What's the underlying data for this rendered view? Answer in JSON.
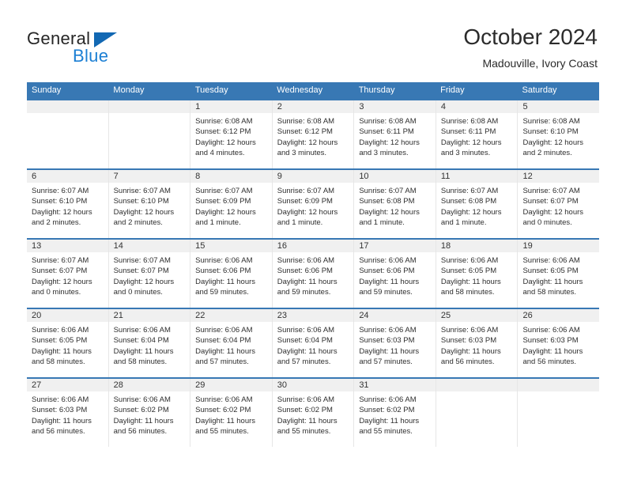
{
  "logo": {
    "word1": "General",
    "word2": "Blue",
    "triangle_color": "#1268b3",
    "blue_color": "#1b7fd4"
  },
  "header": {
    "title": "October 2024",
    "subtitle": "Madouville, Ivory Coast",
    "header_bg": "#3878b4",
    "header_text_color": "#ffffff"
  },
  "calendar": {
    "weekdays": [
      "Sunday",
      "Monday",
      "Tuesday",
      "Wednesday",
      "Thursday",
      "Friday",
      "Saturday"
    ],
    "weeks": [
      [
        {
          "day": "",
          "empty": true
        },
        {
          "day": "",
          "empty": true
        },
        {
          "day": "1",
          "sunrise": "Sunrise: 6:08 AM",
          "sunset": "Sunset: 6:12 PM",
          "daylight1": "Daylight: 12 hours",
          "daylight2": "and 4 minutes."
        },
        {
          "day": "2",
          "sunrise": "Sunrise: 6:08 AM",
          "sunset": "Sunset: 6:12 PM",
          "daylight1": "Daylight: 12 hours",
          "daylight2": "and 3 minutes."
        },
        {
          "day": "3",
          "sunrise": "Sunrise: 6:08 AM",
          "sunset": "Sunset: 6:11 PM",
          "daylight1": "Daylight: 12 hours",
          "daylight2": "and 3 minutes."
        },
        {
          "day": "4",
          "sunrise": "Sunrise: 6:08 AM",
          "sunset": "Sunset: 6:11 PM",
          "daylight1": "Daylight: 12 hours",
          "daylight2": "and 3 minutes."
        },
        {
          "day": "5",
          "sunrise": "Sunrise: 6:08 AM",
          "sunset": "Sunset: 6:10 PM",
          "daylight1": "Daylight: 12 hours",
          "daylight2": "and 2 minutes."
        }
      ],
      [
        {
          "day": "6",
          "sunrise": "Sunrise: 6:07 AM",
          "sunset": "Sunset: 6:10 PM",
          "daylight1": "Daylight: 12 hours",
          "daylight2": "and 2 minutes."
        },
        {
          "day": "7",
          "sunrise": "Sunrise: 6:07 AM",
          "sunset": "Sunset: 6:10 PM",
          "daylight1": "Daylight: 12 hours",
          "daylight2": "and 2 minutes."
        },
        {
          "day": "8",
          "sunrise": "Sunrise: 6:07 AM",
          "sunset": "Sunset: 6:09 PM",
          "daylight1": "Daylight: 12 hours",
          "daylight2": "and 1 minute."
        },
        {
          "day": "9",
          "sunrise": "Sunrise: 6:07 AM",
          "sunset": "Sunset: 6:09 PM",
          "daylight1": "Daylight: 12 hours",
          "daylight2": "and 1 minute."
        },
        {
          "day": "10",
          "sunrise": "Sunrise: 6:07 AM",
          "sunset": "Sunset: 6:08 PM",
          "daylight1": "Daylight: 12 hours",
          "daylight2": "and 1 minute."
        },
        {
          "day": "11",
          "sunrise": "Sunrise: 6:07 AM",
          "sunset": "Sunset: 6:08 PM",
          "daylight1": "Daylight: 12 hours",
          "daylight2": "and 1 minute."
        },
        {
          "day": "12",
          "sunrise": "Sunrise: 6:07 AM",
          "sunset": "Sunset: 6:07 PM",
          "daylight1": "Daylight: 12 hours",
          "daylight2": "and 0 minutes."
        }
      ],
      [
        {
          "day": "13",
          "sunrise": "Sunrise: 6:07 AM",
          "sunset": "Sunset: 6:07 PM",
          "daylight1": "Daylight: 12 hours",
          "daylight2": "and 0 minutes."
        },
        {
          "day": "14",
          "sunrise": "Sunrise: 6:07 AM",
          "sunset": "Sunset: 6:07 PM",
          "daylight1": "Daylight: 12 hours",
          "daylight2": "and 0 minutes."
        },
        {
          "day": "15",
          "sunrise": "Sunrise: 6:06 AM",
          "sunset": "Sunset: 6:06 PM",
          "daylight1": "Daylight: 11 hours",
          "daylight2": "and 59 minutes."
        },
        {
          "day": "16",
          "sunrise": "Sunrise: 6:06 AM",
          "sunset": "Sunset: 6:06 PM",
          "daylight1": "Daylight: 11 hours",
          "daylight2": "and 59 minutes."
        },
        {
          "day": "17",
          "sunrise": "Sunrise: 6:06 AM",
          "sunset": "Sunset: 6:06 PM",
          "daylight1": "Daylight: 11 hours",
          "daylight2": "and 59 minutes."
        },
        {
          "day": "18",
          "sunrise": "Sunrise: 6:06 AM",
          "sunset": "Sunset: 6:05 PM",
          "daylight1": "Daylight: 11 hours",
          "daylight2": "and 58 minutes."
        },
        {
          "day": "19",
          "sunrise": "Sunrise: 6:06 AM",
          "sunset": "Sunset: 6:05 PM",
          "daylight1": "Daylight: 11 hours",
          "daylight2": "and 58 minutes."
        }
      ],
      [
        {
          "day": "20",
          "sunrise": "Sunrise: 6:06 AM",
          "sunset": "Sunset: 6:05 PM",
          "daylight1": "Daylight: 11 hours",
          "daylight2": "and 58 minutes."
        },
        {
          "day": "21",
          "sunrise": "Sunrise: 6:06 AM",
          "sunset": "Sunset: 6:04 PM",
          "daylight1": "Daylight: 11 hours",
          "daylight2": "and 58 minutes."
        },
        {
          "day": "22",
          "sunrise": "Sunrise: 6:06 AM",
          "sunset": "Sunset: 6:04 PM",
          "daylight1": "Daylight: 11 hours",
          "daylight2": "and 57 minutes."
        },
        {
          "day": "23",
          "sunrise": "Sunrise: 6:06 AM",
          "sunset": "Sunset: 6:04 PM",
          "daylight1": "Daylight: 11 hours",
          "daylight2": "and 57 minutes."
        },
        {
          "day": "24",
          "sunrise": "Sunrise: 6:06 AM",
          "sunset": "Sunset: 6:03 PM",
          "daylight1": "Daylight: 11 hours",
          "daylight2": "and 57 minutes."
        },
        {
          "day": "25",
          "sunrise": "Sunrise: 6:06 AM",
          "sunset": "Sunset: 6:03 PM",
          "daylight1": "Daylight: 11 hours",
          "daylight2": "and 56 minutes."
        },
        {
          "day": "26",
          "sunrise": "Sunrise: 6:06 AM",
          "sunset": "Sunset: 6:03 PM",
          "daylight1": "Daylight: 11 hours",
          "daylight2": "and 56 minutes."
        }
      ],
      [
        {
          "day": "27",
          "sunrise": "Sunrise: 6:06 AM",
          "sunset": "Sunset: 6:03 PM",
          "daylight1": "Daylight: 11 hours",
          "daylight2": "and 56 minutes."
        },
        {
          "day": "28",
          "sunrise": "Sunrise: 6:06 AM",
          "sunset": "Sunset: 6:02 PM",
          "daylight1": "Daylight: 11 hours",
          "daylight2": "and 56 minutes."
        },
        {
          "day": "29",
          "sunrise": "Sunrise: 6:06 AM",
          "sunset": "Sunset: 6:02 PM",
          "daylight1": "Daylight: 11 hours",
          "daylight2": "and 55 minutes."
        },
        {
          "day": "30",
          "sunrise": "Sunrise: 6:06 AM",
          "sunset": "Sunset: 6:02 PM",
          "daylight1": "Daylight: 11 hours",
          "daylight2": "and 55 minutes."
        },
        {
          "day": "31",
          "sunrise": "Sunrise: 6:06 AM",
          "sunset": "Sunset: 6:02 PM",
          "daylight1": "Daylight: 11 hours",
          "daylight2": "and 55 minutes."
        },
        {
          "day": "",
          "empty": true
        },
        {
          "day": "",
          "empty": true
        }
      ]
    ]
  }
}
